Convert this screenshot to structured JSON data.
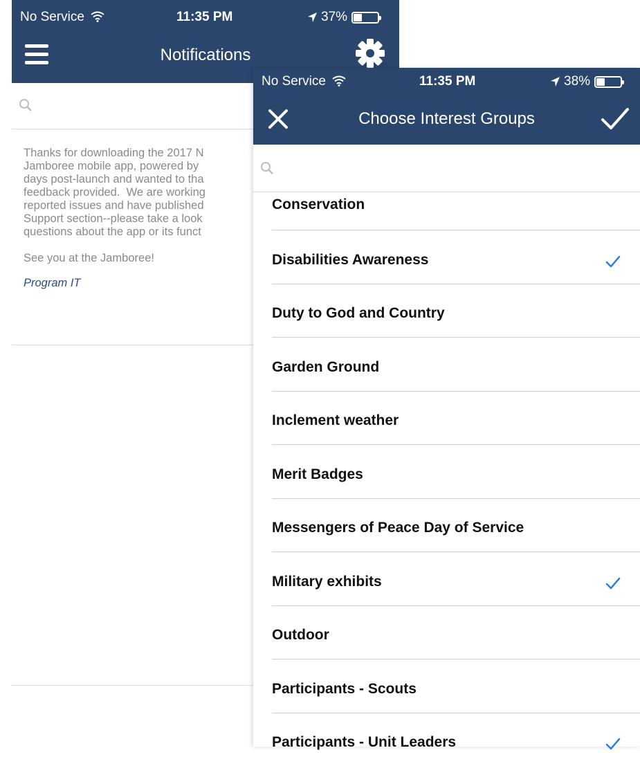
{
  "notifications_screen": {
    "status": {
      "carrier": "No Service",
      "time": "11:35 PM",
      "battery": "37%",
      "battery_level": 0.37
    },
    "title": "Notifications",
    "message_lines": [
      "Thanks for downloading the 2017 N",
      "Jamboree mobile app, powered by ",
      "days post-launch and wanted to tha",
      "feedback provided.  We are working",
      "reported issues and have published",
      "Support section--please take a look",
      "questions about the app or its funct"
    ],
    "closing": "See you at the Jamboree!",
    "signature": "Program IT"
  },
  "interest_screen": {
    "status": {
      "carrier": "No Service",
      "time": "11:35 PM",
      "battery": "38%",
      "battery_level": 0.38
    },
    "title": "Choose Interest Groups",
    "groups": [
      {
        "label": "Conservation",
        "checked": false
      },
      {
        "label": "Disabilities Awareness",
        "checked": true
      },
      {
        "label": "Duty to God and Country",
        "checked": false
      },
      {
        "label": "Garden Ground",
        "checked": false
      },
      {
        "label": "Inclement weather",
        "checked": false
      },
      {
        "label": "Merit Badges",
        "checked": false
      },
      {
        "label": "Messengers of Peace Day of Service",
        "checked": false
      },
      {
        "label": "Military exhibits",
        "checked": true
      },
      {
        "label": "Outdoor",
        "checked": false
      },
      {
        "label": "Participants - Scouts",
        "checked": false
      },
      {
        "label": "Participants - Unit Leaders",
        "checked": true
      }
    ]
  },
  "colors": {
    "nav": "#2a466d",
    "check": "#2f7fd8",
    "signature": "#2a4d80"
  },
  "icons": [
    "wifi-icon",
    "location-arrow-icon",
    "battery-icon",
    "hamburger-menu-icon",
    "gear-icon",
    "search-icon",
    "close-icon",
    "checkmark-icon"
  ]
}
